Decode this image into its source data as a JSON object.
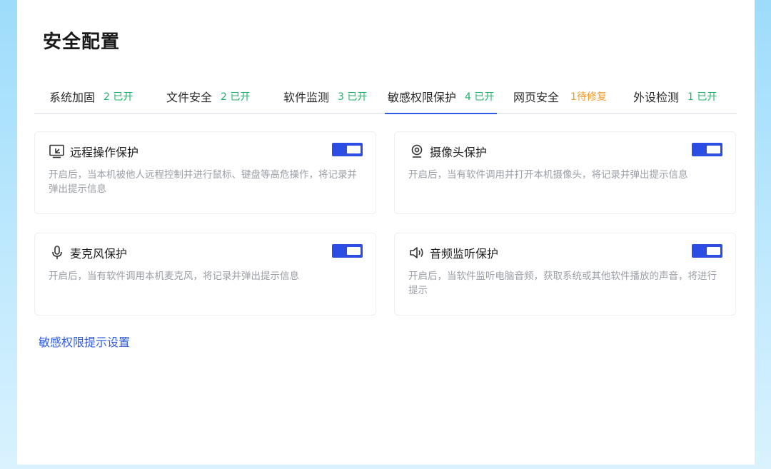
{
  "page": {
    "title": "安全配置"
  },
  "tabs": [
    {
      "label": "系统加固",
      "badge": "2 已开",
      "badge_color": "#20b26b"
    },
    {
      "label": "文件安全",
      "badge": "2 已开",
      "badge_color": "#20b26b"
    },
    {
      "label": "软件监测",
      "badge": "3 已开",
      "badge_color": "#20b26b"
    },
    {
      "label": "敏感权限保护",
      "badge": "4 已开",
      "badge_color": "#20b26b",
      "active": true
    },
    {
      "label": "网页安全",
      "badge": "1待修复",
      "badge_color": "#f29a2e"
    },
    {
      "label": "外设检测",
      "badge": "1 已开",
      "badge_color": "#20b26b"
    }
  ],
  "cards": [
    {
      "icon": "remote-screen-icon",
      "title": "远程操作保护",
      "desc": "开启后，当本机被他人远程控制并进行鼠标、键盘等高危操作，将记录并弹出提示信息",
      "enabled": true
    },
    {
      "icon": "camera-icon",
      "title": "摄像头保护",
      "desc": "开启后，当有软件调用并打开本机摄像头，将记录并弹出提示信息",
      "enabled": true
    },
    {
      "icon": "microphone-icon",
      "title": "麦克风保护",
      "desc": "开启后，当有软件调用本机麦克风，将记录并弹出提示信息",
      "enabled": true
    },
    {
      "icon": "speaker-icon",
      "title": "音频监听保护",
      "desc": "开启后，当软件监听电脑音频，获取系统或其他软件播放的声音，将进行提示",
      "enabled": true
    }
  ],
  "footer": {
    "link_label": "敏感权限提示设置"
  },
  "colors": {
    "accent": "#2b4de3",
    "success": "#20b26b",
    "warning": "#f29a2e"
  }
}
